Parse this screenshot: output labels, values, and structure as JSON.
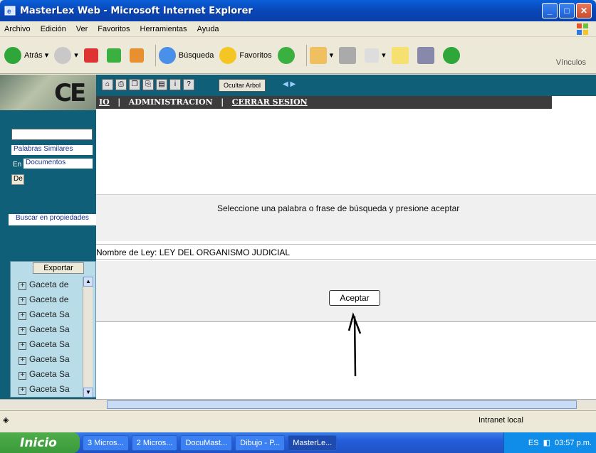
{
  "window": {
    "title": "MasterLex Web - Microsoft Internet Explorer"
  },
  "menubar": [
    "Archivo",
    "Edición",
    "Ver",
    "Favoritos",
    "Herramientas",
    "Ayuda"
  ],
  "toolbar": {
    "back": "Atrás",
    "search": "Búsqueda",
    "favorites": "Favoritos",
    "links": "Vínculos"
  },
  "left": {
    "palabras": "Palabras Similares",
    "en": "En",
    "documentos": "Documentos",
    "de": "De",
    "buscar": "Buscar en propiedades",
    "exportar": "Exportar",
    "tree": [
      "Gaceta de",
      "Gaceta de",
      "Gaceta Sa",
      "Gaceta Sa",
      "Gaceta Sa",
      "Gaceta Sa",
      "Gaceta Sa",
      "Gaceta Sa"
    ]
  },
  "navbar": {
    "ocultar": "Ocultar Arbol"
  },
  "menu2": {
    "inicio": "IO",
    "admin": "ADMINISTRACION",
    "cerrar": "CERRAR SESION",
    "sep": "|"
  },
  "main": {
    "message": "Seleccione una palabra o frase de búsqueda y presione aceptar",
    "ley": "Nombre de Ley: LEY DEL ORGANISMO JUDICIAL",
    "aceptar": "Aceptar"
  },
  "status": {
    "zone": "Intranet local"
  },
  "taskbar": {
    "start": "Inicio",
    "tasks": [
      "3 Micros...",
      "2 Micros...",
      "DocuMast...",
      "Dibujo - P...",
      "MasterLe..."
    ],
    "lang": "ES",
    "time": "03:57 p.m."
  }
}
